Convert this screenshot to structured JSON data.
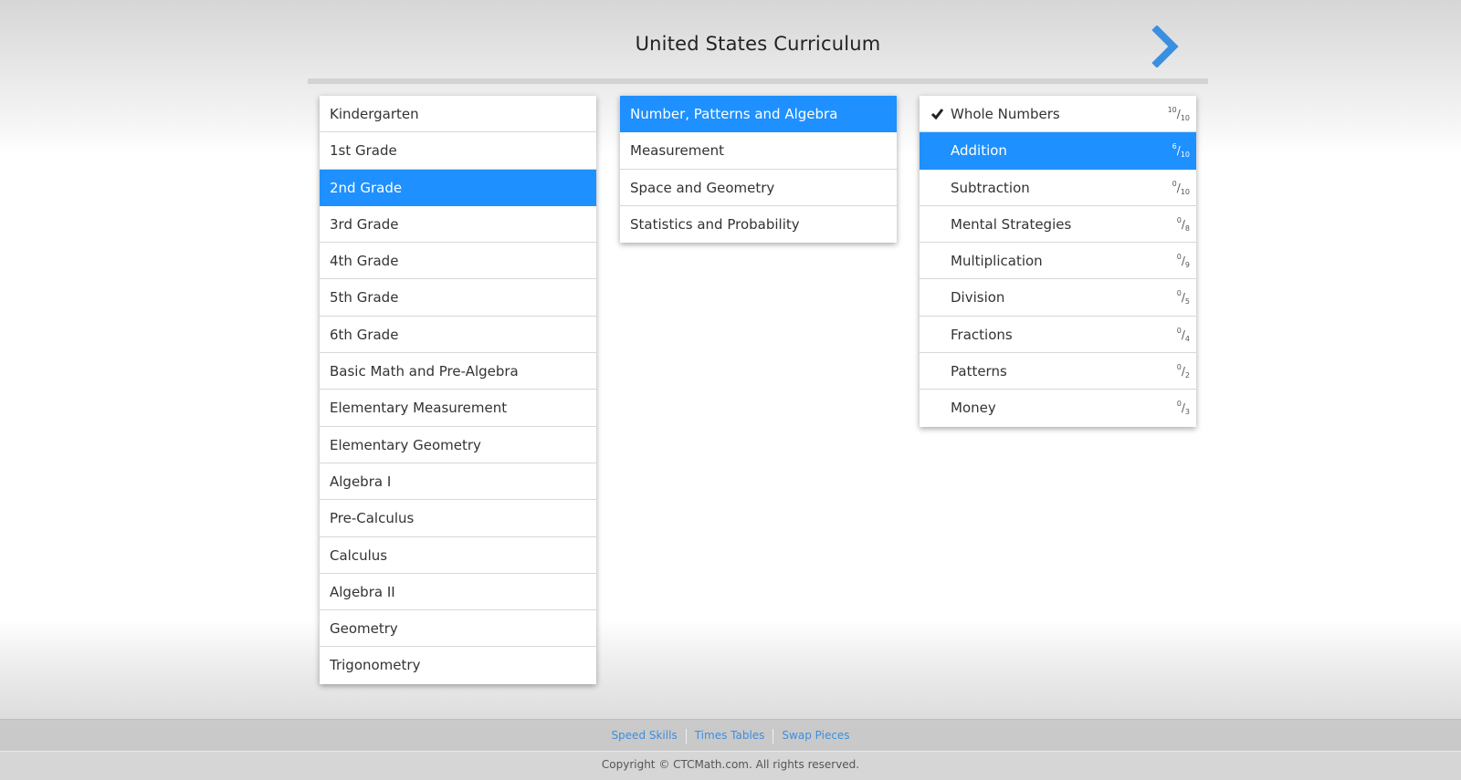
{
  "header": {
    "title": "United States Curriculum",
    "next_icon": "chevron-right-icon",
    "accent_color": "#3b8fe0"
  },
  "grades": [
    "Kindergarten",
    "1st Grade",
    "2nd Grade",
    "3rd Grade",
    "4th Grade",
    "5th Grade",
    "6th Grade",
    "Basic Math and Pre-Algebra",
    "Elementary Measurement",
    "Elementary Geometry",
    "Algebra I",
    "Pre-Calculus",
    "Calculus",
    "Algebra II",
    "Geometry",
    "Trigonometry"
  ],
  "selected_grade": "2nd Grade",
  "strands": [
    "Number, Patterns and Algebra",
    "Measurement",
    "Space and Geometry",
    "Statistics and Probability"
  ],
  "selected_strand": "Number, Patterns and Algebra",
  "topics": [
    {
      "label": "Whole Numbers",
      "done": "10",
      "total": "10",
      "completed": true
    },
    {
      "label": "Addition",
      "done": "6",
      "total": "10",
      "completed": false
    },
    {
      "label": "Subtraction",
      "done": "0",
      "total": "10",
      "completed": false
    },
    {
      "label": "Mental Strategies",
      "done": "0",
      "total": "8",
      "completed": false
    },
    {
      "label": "Multiplication",
      "done": "0",
      "total": "9",
      "completed": false
    },
    {
      "label": "Division",
      "done": "0",
      "total": "5",
      "completed": false
    },
    {
      "label": "Fractions",
      "done": "0",
      "total": "4",
      "completed": false
    },
    {
      "label": "Patterns",
      "done": "0",
      "total": "2",
      "completed": false
    },
    {
      "label": "Money",
      "done": "0",
      "total": "3",
      "completed": false
    }
  ],
  "selected_topic": "Addition",
  "selection_color": "#1e90ff",
  "footer": {
    "links": [
      "Speed Skills",
      "Times Tables",
      "Swap Pieces"
    ],
    "copyright": "Copyright © CTCMath.com. All rights reserved."
  }
}
